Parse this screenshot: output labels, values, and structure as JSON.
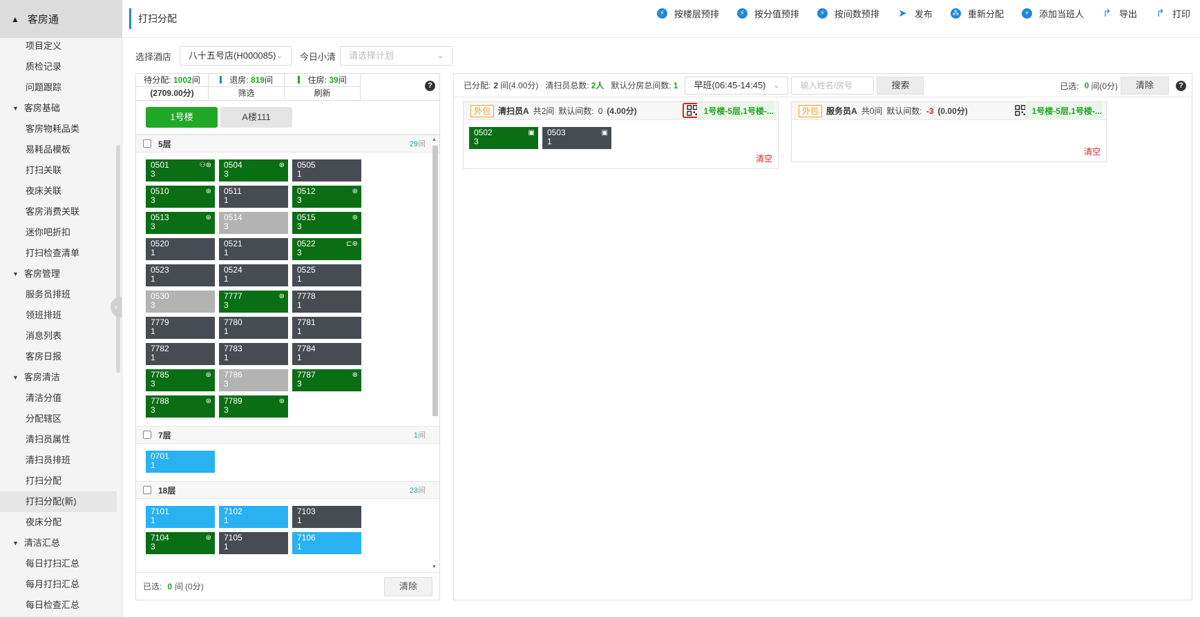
{
  "sidebar": {
    "app_title": "客房通",
    "items": [
      {
        "type": "item",
        "label": "项目定义"
      },
      {
        "type": "item",
        "label": "质检记录"
      },
      {
        "type": "item",
        "label": "问题跟踪"
      },
      {
        "type": "group",
        "label": "客房基础"
      },
      {
        "type": "item",
        "label": "客房物耗品类"
      },
      {
        "type": "item",
        "label": "易耗品模板"
      },
      {
        "type": "item",
        "label": "打扫关联"
      },
      {
        "type": "item",
        "label": "夜床关联"
      },
      {
        "type": "item",
        "label": "客房消费关联"
      },
      {
        "type": "item",
        "label": "迷你吧折扣"
      },
      {
        "type": "item",
        "label": "打扫检查清单"
      },
      {
        "type": "group",
        "label": "客房管理"
      },
      {
        "type": "item",
        "label": "服务员排班"
      },
      {
        "type": "item",
        "label": "领班排班"
      },
      {
        "type": "item",
        "label": "消息列表"
      },
      {
        "type": "item",
        "label": "客房日报"
      },
      {
        "type": "group",
        "label": "客房清洁"
      },
      {
        "type": "item",
        "label": "清洁分值"
      },
      {
        "type": "item",
        "label": "分配辖区"
      },
      {
        "type": "item",
        "label": "清扫员属性"
      },
      {
        "type": "item",
        "label": "清扫员排班"
      },
      {
        "type": "item",
        "label": "打扫分配"
      },
      {
        "type": "item",
        "label": "打扫分配(新)",
        "active": true
      },
      {
        "type": "item",
        "label": "夜床分配"
      },
      {
        "type": "group",
        "label": "清洁汇总"
      },
      {
        "type": "item",
        "label": "每日打扫汇总"
      },
      {
        "type": "item",
        "label": "每月打扫汇总"
      },
      {
        "type": "item",
        "label": "每日检查汇总"
      }
    ]
  },
  "header": {
    "page_title": "打扫分配",
    "toolbar": [
      {
        "label": "按楼层预排",
        "icon": "bolt-icon",
        "glyph": "⚡"
      },
      {
        "label": "按分值预排",
        "icon": "bolt-icon",
        "glyph": "⚡"
      },
      {
        "label": "按间数预排",
        "icon": "bolt-icon",
        "glyph": "⚡"
      },
      {
        "label": "发布",
        "icon": "send-icon",
        "glyph": "➤"
      },
      {
        "label": "重新分配",
        "icon": "redistribute-icon",
        "glyph": "⁂"
      },
      {
        "label": "添加当班人",
        "icon": "add-icon",
        "glyph": "+"
      },
      {
        "label": "导出",
        "icon": "share-icon",
        "glyph": "↱"
      },
      {
        "label": "打印",
        "icon": "share-icon",
        "glyph": "↱"
      }
    ]
  },
  "filters": {
    "hotel_label": "选择酒店",
    "hotel_value": "八十五号店(H000085)",
    "plan_label": "今日小清",
    "plan_placeholder": "请选择计划"
  },
  "left": {
    "pending_label": "待分配:",
    "pending_count": "1002",
    "unit": "间",
    "checkout_label": "退房:",
    "checkout_count": "819",
    "stay_label": "住房:",
    "stay_count": "39",
    "score_total": "(2709.00分)",
    "filter_label": "筛选",
    "refresh_label": "刷新",
    "help": "?",
    "building_tabs": [
      "1号楼",
      "A楼111"
    ],
    "floors": [
      {
        "name": "5层",
        "count": "29",
        "unit": "间",
        "rooms": [
          {
            "no": "0501",
            "v": "3",
            "c": "g",
            "icon": "⚇⊛"
          },
          {
            "no": "0504",
            "v": "3",
            "c": "g",
            "icon": "⊛"
          },
          {
            "no": "0505",
            "v": "1",
            "c": "d",
            "icon": ""
          },
          {
            "no": "0510",
            "v": "3",
            "c": "g",
            "icon": "⊛"
          },
          {
            "no": "0511",
            "v": "1",
            "c": "d",
            "icon": ""
          },
          {
            "no": "0512",
            "v": "3",
            "c": "g",
            "icon": "⊛"
          },
          {
            "no": "0513",
            "v": "3",
            "c": "g",
            "icon": "⊛"
          },
          {
            "no": "0514",
            "v": "3",
            "c": "l",
            "icon": ""
          },
          {
            "no": "0515",
            "v": "3",
            "c": "g",
            "icon": "⊛"
          },
          {
            "no": "0520",
            "v": "1",
            "c": "d",
            "icon": ""
          },
          {
            "no": "0521",
            "v": "1",
            "c": "d",
            "icon": ""
          },
          {
            "no": "0522",
            "v": "3",
            "c": "g",
            "icon": "⊏⊛"
          },
          {
            "no": "0523",
            "v": "1",
            "c": "d",
            "icon": ""
          },
          {
            "no": "0524",
            "v": "1",
            "c": "d",
            "icon": ""
          },
          {
            "no": "0525",
            "v": "1",
            "c": "d",
            "icon": ""
          },
          {
            "no": "0530",
            "v": "3",
            "c": "l",
            "icon": ""
          },
          {
            "no": "7777",
            "v": "3",
            "c": "g",
            "icon": "⊛"
          },
          {
            "no": "7778",
            "v": "1",
            "c": "d",
            "icon": ""
          },
          {
            "no": "7779",
            "v": "1",
            "c": "d",
            "icon": ""
          },
          {
            "no": "7780",
            "v": "1",
            "c": "d",
            "icon": ""
          },
          {
            "no": "7781",
            "v": "1",
            "c": "d",
            "icon": ""
          },
          {
            "no": "7782",
            "v": "1",
            "c": "d",
            "icon": ""
          },
          {
            "no": "7783",
            "v": "1",
            "c": "d",
            "icon": ""
          },
          {
            "no": "7784",
            "v": "1",
            "c": "d",
            "icon": ""
          },
          {
            "no": "7785",
            "v": "3",
            "c": "g",
            "icon": "⊛"
          },
          {
            "no": "7786",
            "v": "3",
            "c": "l",
            "icon": ""
          },
          {
            "no": "7787",
            "v": "3",
            "c": "g",
            "icon": "⊛"
          },
          {
            "no": "7788",
            "v": "3",
            "c": "g",
            "icon": "⊛"
          },
          {
            "no": "7789",
            "v": "3",
            "c": "g",
            "icon": "⊛"
          }
        ]
      },
      {
        "name": "7层",
        "count": "1",
        "unit": "间",
        "rooms": [
          {
            "no": "0701",
            "v": "1",
            "c": "b",
            "icon": ""
          }
        ]
      },
      {
        "name": "18层",
        "count": "23",
        "unit": "间",
        "rooms": [
          {
            "no": "7101",
            "v": "1",
            "c": "b",
            "icon": ""
          },
          {
            "no": "7102",
            "v": "1",
            "c": "b",
            "icon": ""
          },
          {
            "no": "7103",
            "v": "1",
            "c": "d",
            "icon": ""
          },
          {
            "no": "7104",
            "v": "3",
            "c": "g",
            "icon": "⊛"
          },
          {
            "no": "7105",
            "v": "1",
            "c": "d",
            "icon": ""
          },
          {
            "no": "7106",
            "v": "1",
            "c": "b",
            "icon": ""
          }
        ]
      }
    ],
    "footer_selected_label": "已选:",
    "footer_selected_count": "0",
    "footer_selected_unit": "间",
    "footer_selected_score": "(0分)",
    "clear_button": "清除"
  },
  "right": {
    "assigned_label": "已分配:",
    "assigned_count": "2",
    "assigned_unit": "间(4.00分)",
    "cleaners_label": "清扫员总数:",
    "cleaners_count": "2人",
    "default_label": "默认分房总间数:",
    "default_count": "1",
    "shift_value": "早班(06:45-14:45)",
    "name_placeholder": "输入姓名/房号",
    "search_button": "搜索",
    "selected_label": "已选:",
    "selected_count": "0",
    "selected_unit": "间(0分)",
    "clear_button": "清除",
    "help": "?",
    "cards": [
      {
        "tag": "外包",
        "name": "清扫员A",
        "total_label": "共2间",
        "default_label": "默认间数:",
        "default_value": "0",
        "score": "(4.00分)",
        "floors": "1号楼-5层,1号楼-...",
        "clear_label": "清空",
        "rooms": [
          {
            "no": "0502",
            "v": "3",
            "c": "g",
            "icon": "▣"
          },
          {
            "no": "0503",
            "v": "1",
            "c": "d",
            "icon": "▣"
          }
        ]
      },
      {
        "tag": "外包",
        "name": "服务员A",
        "total_label": "共0间",
        "default_label": "默认间数:",
        "default_value": "-3",
        "score": "(0.00分)",
        "floors": "1号楼-5层,1号楼-...",
        "clear_label": "清空",
        "rooms": []
      }
    ]
  }
}
